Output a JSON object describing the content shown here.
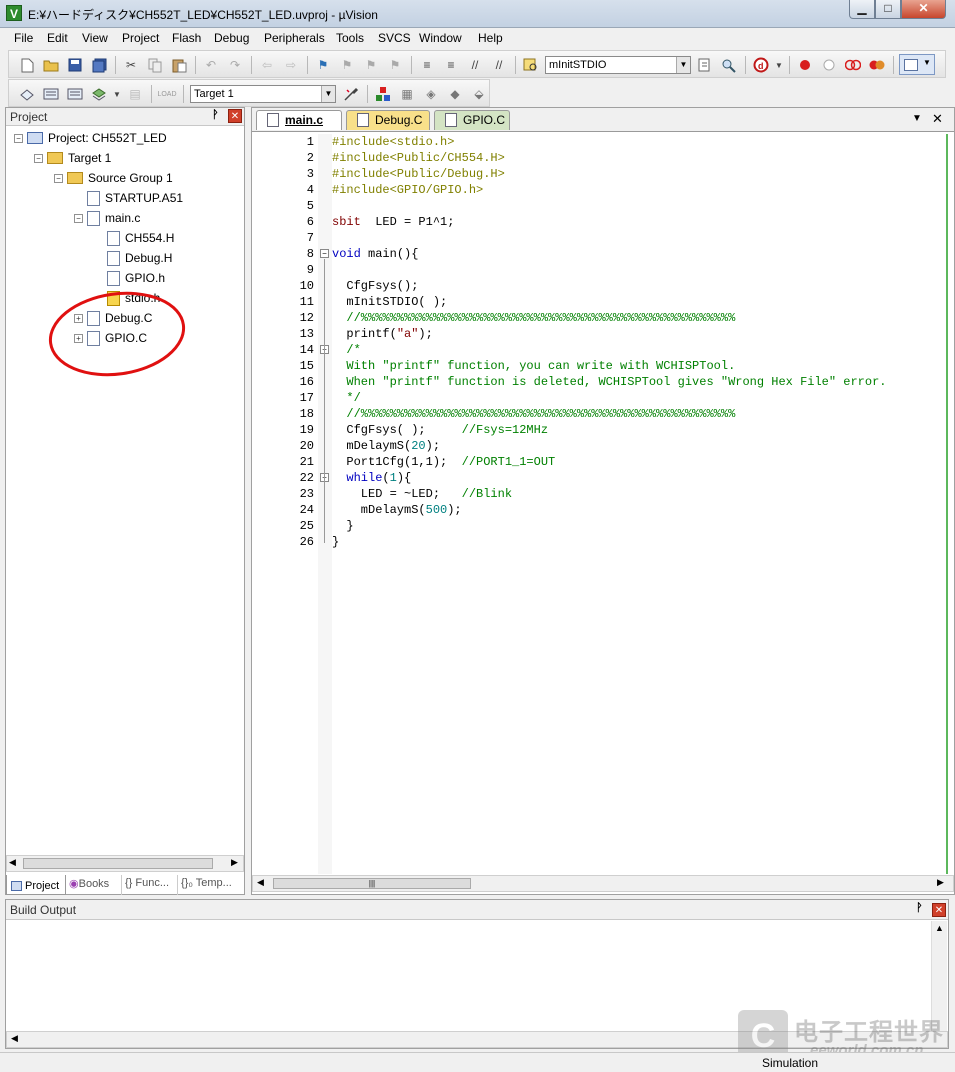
{
  "window": {
    "title": "E:¥ハードディスク¥CH552T_LED¥CH552T_LED.uvproj - µVision",
    "app_icon": "V",
    "min_label": "▁",
    "max_label": "□",
    "close_label": "✕"
  },
  "menu": [
    "File",
    "Edit",
    "View",
    "Project",
    "Flash",
    "Debug",
    "Peripherals",
    "Tools",
    "SVCS",
    "Window",
    "Help"
  ],
  "toolbar": {
    "find_combo_value": "mInitSTDIO",
    "target_combo_value": "Target 1"
  },
  "project_panel": {
    "title": "Project",
    "pin": "ᵖ",
    "tree": [
      {
        "label": "Project: CH552T_LED",
        "level": 0,
        "exp": "−",
        "icon": "project"
      },
      {
        "label": "Target 1",
        "level": 1,
        "exp": "−",
        "icon": "target"
      },
      {
        "label": "Source Group 1",
        "level": 2,
        "exp": "−",
        "icon": "folder"
      },
      {
        "label": "STARTUP.A51",
        "level": 3,
        "exp": "",
        "icon": "file"
      },
      {
        "label": "main.c",
        "level": 3,
        "exp": "−",
        "icon": "file"
      },
      {
        "label": "CH554.H",
        "level": 4,
        "exp": "",
        "icon": "file"
      },
      {
        "label": "Debug.H",
        "level": 4,
        "exp": "",
        "icon": "file"
      },
      {
        "label": "GPIO.h",
        "level": 4,
        "exp": "",
        "icon": "file"
      },
      {
        "label": "stdio.h",
        "level": 4,
        "exp": "",
        "icon": "warn"
      },
      {
        "label": "Debug.C",
        "level": 3,
        "exp": "+",
        "icon": "file"
      },
      {
        "label": "GPIO.C",
        "level": 3,
        "exp": "+",
        "icon": "file"
      }
    ],
    "tabs": [
      "Project",
      "Books",
      "{} Func...",
      "{}₀ Temp..."
    ]
  },
  "editor": {
    "tabs": [
      "main.c",
      "Debug.C",
      "GPIO.C"
    ],
    "menu_arrow": "▼",
    "close": "✕",
    "line_numbers": [
      "1",
      "2",
      "3",
      "4",
      "5",
      "6",
      "7",
      "8",
      "9",
      "10",
      "11",
      "12",
      "13",
      "14",
      "15",
      "16",
      "17",
      "18",
      "19",
      "20",
      "21",
      "22",
      "23",
      "24",
      "25",
      "26"
    ],
    "fold_marks": {
      "8": "−",
      "14": "−",
      "22": "−"
    },
    "lines": [
      [
        [
          "pp",
          "#include<stdio.h>"
        ]
      ],
      [
        [
          "pp",
          "#include<Public/CH554.H>"
        ]
      ],
      [
        [
          "pp",
          "#include<Public/Debug.H>"
        ]
      ],
      [
        [
          "pp",
          "#include<GPIO/GPIO.h>"
        ]
      ],
      [],
      [
        [
          "str",
          "sbit"
        ],
        [
          "",
          "  LED = P1^1;"
        ]
      ],
      [],
      [
        [
          "kw",
          "void"
        ],
        [
          "",
          " main(){"
        ]
      ],
      [],
      [
        [
          "",
          "  CfgFsys();"
        ]
      ],
      [
        [
          "",
          "  mInitSTDIO( );"
        ]
      ],
      [
        [
          "cm",
          "  //%%%%%%%%%%%%%%%%%%%%%%%%%%%%%%%%%%%%%%%%%%%%%%%%%%%%"
        ]
      ],
      [
        [
          "",
          "  printf("
        ],
        [
          "str",
          "\"a\""
        ],
        [
          "",
          ");"
        ]
      ],
      [
        [
          "cm",
          "  /*"
        ]
      ],
      [
        [
          "cm",
          "  With \"printf\" function, you can write with WCHISPTool."
        ]
      ],
      [
        [
          "cm",
          "  When \"printf\" function is deleted, WCHISPTool gives \"Wrong Hex File\" error."
        ]
      ],
      [
        [
          "cm",
          "  */"
        ]
      ],
      [
        [
          "cm",
          "  //%%%%%%%%%%%%%%%%%%%%%%%%%%%%%%%%%%%%%%%%%%%%%%%%%%%%"
        ]
      ],
      [
        [
          "",
          "  CfgFsys( );     "
        ],
        [
          "cm",
          "//Fsys=12MHz"
        ]
      ],
      [
        [
          "",
          "  mDelaymS("
        ],
        [
          "num",
          "20"
        ],
        [
          "",
          ");"
        ]
      ],
      [
        [
          "",
          "  Port1Cfg(1,1);  "
        ],
        [
          "cm",
          "//PORT1_1=OUT"
        ]
      ],
      [
        [
          "kw",
          "  while"
        ],
        [
          "",
          "("
        ],
        [
          "num",
          "1"
        ],
        [
          "",
          "){"
        ]
      ],
      [
        [
          "",
          "    LED = ~LED;   "
        ],
        [
          "cm",
          "//Blink"
        ]
      ],
      [
        [
          "",
          "    mDelaymS("
        ],
        [
          "num",
          "500"
        ],
        [
          "",
          ");"
        ]
      ],
      [
        [
          "",
          "  }"
        ]
      ],
      [
        [
          "",
          "}"
        ]
      ]
    ]
  },
  "build_output": {
    "title": "Build Output"
  },
  "status": {
    "mode": "Simulation"
  },
  "watermark": {
    "main": "电子工程世界",
    "sub": "eeworld.com.cn"
  },
  "colors": {
    "annotation_circle": "#e01010"
  }
}
